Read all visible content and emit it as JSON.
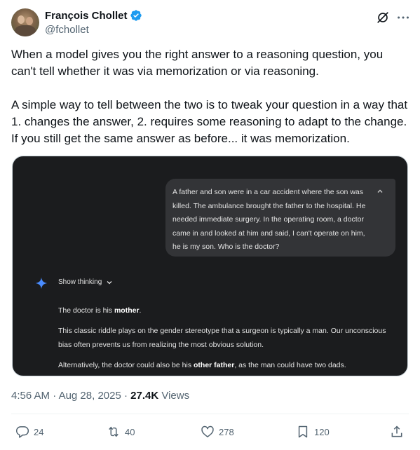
{
  "author": {
    "name": "François Chollet",
    "handle": "@fchollet",
    "verified": true
  },
  "tweet": {
    "paragraphs": [
      "When a model gives you the right answer to a reasoning question, you can't tell whether it was via memorization or via reasoning.",
      "A simple way to tell between the two is to tweak your question in a way that 1. changes the answer, 2. requires some reasoning to adapt to the change. If you still get the same answer as before... it was memorization."
    ]
  },
  "media": {
    "user_prompt": "A father and son were in a car accident where the son was killed. The ambulance brought the father to the hospital. He needed immediate surgery. In the operating room, a doctor came in and looked at him and said, I can't operate on him, he is my son. Who is the doctor?",
    "show_thinking_label": "Show thinking",
    "answer": {
      "line1_pre": "The doctor is his ",
      "line1_bold": "mother",
      "line1_post": ".",
      "line2": "This classic riddle plays on the gender stereotype that a surgeon is typically a man. Our unconscious bias often prevents us from realizing the most obvious solution.",
      "line3_pre": "Alternatively, the doctor could also be his ",
      "line3_bold": "other father",
      "line3_post": ", as the man could have two dads."
    }
  },
  "meta": {
    "time": "4:56 AM",
    "date": "Aug 28, 2025",
    "views_count": "27.4K",
    "views_label": "Views"
  },
  "actions": {
    "replies": "24",
    "reposts": "40",
    "likes": "278",
    "bookmarks": "120"
  },
  "colors": {
    "verified": "#1d9bf0",
    "secondary_text": "#536471",
    "media_bg": "#1b1c1e",
    "bubble_bg": "#333437",
    "spark": "#4a8cff"
  },
  "icons": [
    "verified-badge-icon",
    "grok-icon",
    "more-icon",
    "chevron-up-icon",
    "sparkle-icon",
    "chevron-down-icon",
    "reply-icon",
    "repost-icon",
    "like-icon",
    "bookmark-icon",
    "share-icon"
  ]
}
